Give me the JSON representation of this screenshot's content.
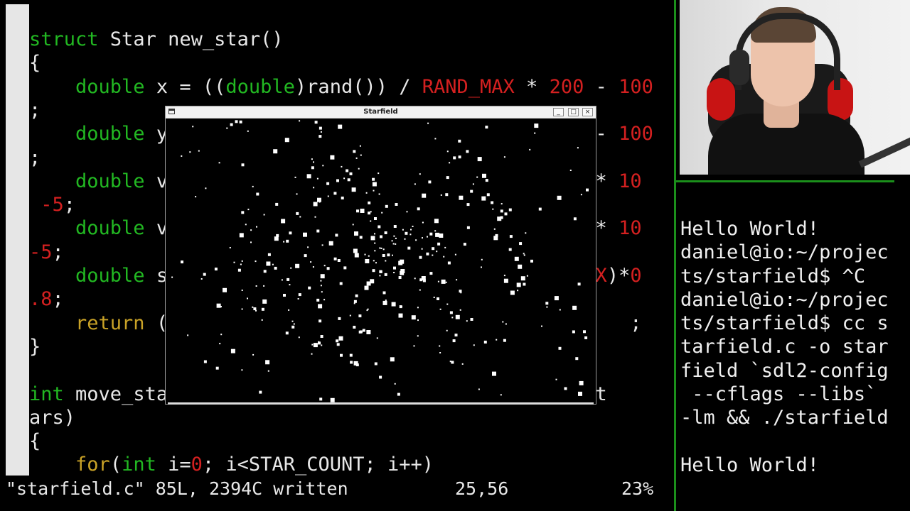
{
  "editor": {
    "lines": [
      {
        "segments": [
          {
            "t": "struct",
            "c": "kw-g"
          },
          {
            "t": " Star new_star()"
          }
        ]
      },
      {
        "segments": [
          {
            "t": "{"
          }
        ]
      },
      {
        "segments": [
          {
            "t": "    "
          },
          {
            "t": "double",
            "c": "kw-g"
          },
          {
            "t": " x = (("
          },
          {
            "t": "double",
            "c": "kw-g"
          },
          {
            "t": ")rand()) / "
          },
          {
            "t": "RAND_MAX",
            "c": "red"
          },
          {
            "t": " * "
          },
          {
            "t": "200",
            "c": "red"
          },
          {
            "t": " - "
          },
          {
            "t": "100",
            "c": "red"
          }
        ]
      },
      {
        "segments": [
          {
            "t": ";"
          }
        ]
      },
      {
        "segments": [
          {
            "t": "    "
          },
          {
            "t": "double",
            "c": "kw-g"
          },
          {
            "t": " y"
          },
          {
            "t": "                                     - "
          },
          {
            "t": "100",
            "c": "red"
          }
        ]
      },
      {
        "segments": [
          {
            "t": ";"
          }
        ]
      },
      {
        "segments": [
          {
            "t": "    "
          },
          {
            "t": "double",
            "c": "kw-g"
          },
          {
            "t": " v"
          },
          {
            "t": "                                   ) * "
          },
          {
            "t": "10",
            "c": "red"
          }
        ]
      },
      {
        "segments": [
          {
            "t": " "
          },
          {
            "t": "-5",
            "c": "red"
          },
          {
            "t": ";"
          }
        ]
      },
      {
        "segments": [
          {
            "t": "    "
          },
          {
            "t": "double",
            "c": "kw-g"
          },
          {
            "t": " v"
          },
          {
            "t": "                                   ) * "
          },
          {
            "t": "10",
            "c": "red"
          }
        ]
      },
      {
        "segments": [
          {
            "t": "-5",
            "c": "red"
          },
          {
            "t": ";"
          }
        ]
      },
      {
        "segments": [
          {
            "t": "    "
          },
          {
            "t": "double",
            "c": "kw-g"
          },
          {
            "t": " s"
          },
          {
            "t": "                                   "
          },
          {
            "t": "MAX",
            "c": "red"
          },
          {
            "t": ")*"
          },
          {
            "t": "0",
            "c": "red"
          }
        ]
      },
      {
        "segments": [
          {
            "t": ".8",
            "c": "red"
          },
          {
            "t": ";"
          }
        ]
      },
      {
        "segments": [
          {
            "t": "    "
          },
          {
            "t": "return",
            "c": "kw-y"
          },
          {
            "t": " ("
          },
          {
            "t": "                                        ;"
          }
        ]
      },
      {
        "segments": [
          {
            "t": "}"
          }
        ]
      },
      {
        "segments": [
          {
            "t": ""
          }
        ]
      },
      {
        "segments": [
          {
            "t": "int",
            "c": "kw-g"
          },
          {
            "t": " move_sta"
          },
          {
            "t": "                                r *pst"
          }
        ]
      },
      {
        "segments": [
          {
            "t": "ars)"
          }
        ]
      },
      {
        "segments": [
          {
            "t": "{"
          }
        ]
      },
      {
        "segments": [
          {
            "t": "    "
          },
          {
            "t": "for",
            "c": "kw-y"
          },
          {
            "t": "("
          },
          {
            "t": "int",
            "c": "kw-g"
          },
          {
            "t": " i="
          },
          {
            "t": "0",
            "c": "red"
          },
          {
            "t": "; i<STAR_COUNT; i++)"
          }
        ]
      }
    ],
    "status_file": "\"starfield.c\" 85L, 2394C written",
    "status_pos": "25,56",
    "status_pct": "23%"
  },
  "terminal": {
    "lines": [
      "Hello World!",
      "daniel@io:~/projec",
      "ts/starfield$ ^C",
      "daniel@io:~/projec",
      "ts/starfield$ cc s",
      "tarfield.c -o star",
      "field `sdl2-config",
      " --cflags --libs`",
      "-lm && ./starfield",
      "",
      "Hello World!"
    ]
  },
  "window": {
    "title": "Starfield",
    "minimize_glyph": "_",
    "maximize_glyph": "□",
    "close_glyph": "×",
    "star_count": 420,
    "star_color": "#ffffff"
  },
  "colors": {
    "green_keyword": "#22b822",
    "yellow_keyword": "#c9a227",
    "red_literal": "#d42020",
    "divider": "#1b8f1b"
  },
  "webcam": {
    "icon": "person-webcam-icon"
  }
}
